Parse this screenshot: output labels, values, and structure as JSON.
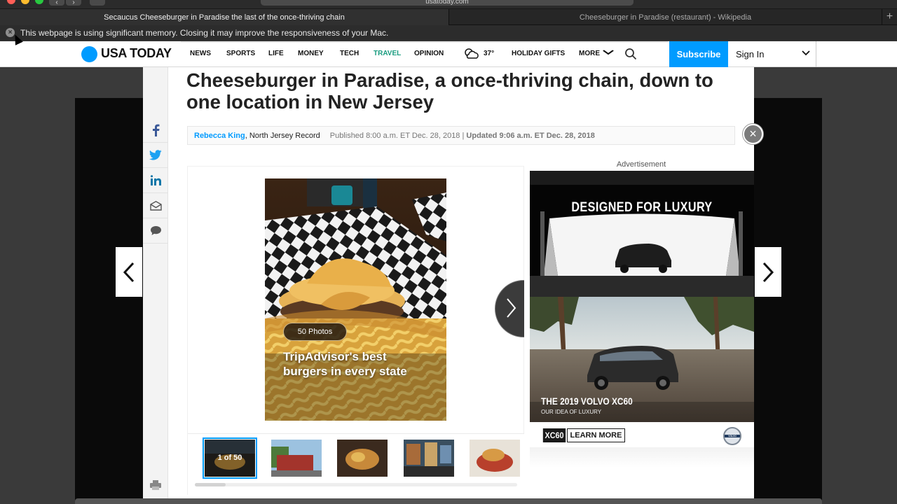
{
  "browser": {
    "address": "usatoday.com",
    "tabs": [
      {
        "label": "Secaucus Cheeseburger in Paradise the last of the once-thriving chain",
        "active": true
      },
      {
        "label": "Cheeseburger in Paradise (restaurant) - Wikipedia",
        "active": false
      }
    ],
    "new_tab_label": "+",
    "warning": {
      "text": "This webpage is using significant memory. Closing it may improve the responsiveness of your Mac.",
      "close_label": "×"
    }
  },
  "header": {
    "logo": "USA TODAY",
    "nav": [
      {
        "label": "NEWS",
        "active": false
      },
      {
        "label": "SPORTS",
        "active": false
      },
      {
        "label": "LIFE",
        "active": false
      },
      {
        "label": "MONEY",
        "active": false
      },
      {
        "label": "TECH",
        "active": false
      },
      {
        "label": "TRAVEL",
        "active": true
      },
      {
        "label": "OPINION",
        "active": false
      }
    ],
    "weather_temp": "37°",
    "holiday_gifts": "HOLIDAY GIFTS",
    "more": "MORE",
    "subscribe": "Subscribe",
    "sign_in": "Sign In"
  },
  "article": {
    "headline": "Cheeseburger in Paradise, a once-thriving chain, down to one location in New Jersey",
    "author": "Rebecca King",
    "source": ", North Jersey Record",
    "published": "Published 8:00 a.m. ET Dec. 28, 2018 |",
    "updated": "Updated 9:06 a.m. ET Dec. 28, 2018"
  },
  "gallery": {
    "photo_count_badge": "50 Photos",
    "caption": "TripAdvisor's best burgers in every state",
    "counter": "1 of 50",
    "thumbnail_count": 5,
    "active_thumbnail": 1
  },
  "ad": {
    "label": "Advertisement",
    "headline": "DESIGNED FOR LUXURY",
    "model": "THE 2019 VOLVO XC60",
    "tagline": "OUR IDEA OF LUXURY",
    "badge": "XC60",
    "cta": "LEARN MORE",
    "brand_logo_text": "VOLVO"
  },
  "colors": {
    "brand_blue": "#009bff",
    "travel_green": "#1a9c80",
    "headline_text": "#222222"
  }
}
